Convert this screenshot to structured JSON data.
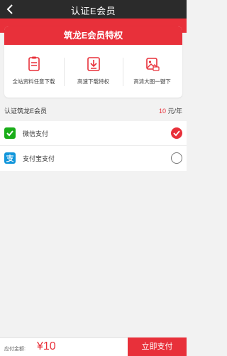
{
  "header": {
    "title": "认证E会员"
  },
  "card": {
    "banner_title": "筑龙E会员特权",
    "features": [
      {
        "label": "全站资料任意下载",
        "icon": "document-icon"
      },
      {
        "label": "高速下载特权",
        "icon": "download-icon"
      },
      {
        "label": "高清大图一键下",
        "icon": "image-download-icon"
      }
    ]
  },
  "plan": {
    "label": "认证筑龙E会员",
    "price_value": "10",
    "price_unit": " 元/年"
  },
  "payment": {
    "options": [
      {
        "label": "微信支付",
        "icon": "wechat-pay-icon",
        "selected": true
      },
      {
        "label": "支付宝支付",
        "icon": "alipay-icon",
        "selected": false
      }
    ]
  },
  "footer": {
    "due_label": "应付金额:",
    "amount": "¥10",
    "pay_button": "立即支付"
  },
  "colors": {
    "accent": "#e8303a",
    "header_bg": "#2b2b2b",
    "wechat": "#1aad19",
    "alipay": "#1296db"
  }
}
